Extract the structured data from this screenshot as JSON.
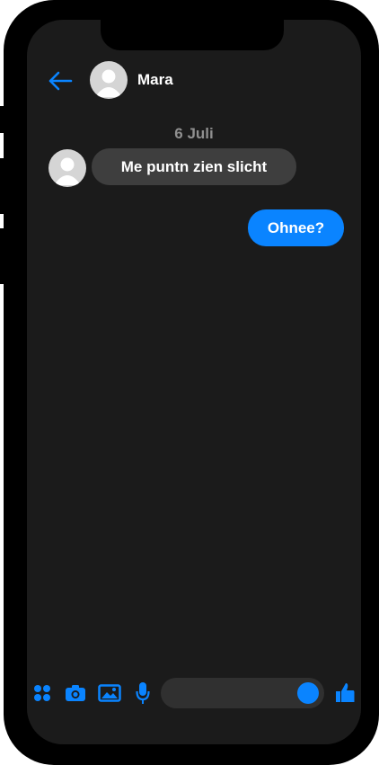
{
  "header": {
    "contact_name": "Mara",
    "back_icon": "arrow-left-icon",
    "avatar_icon": "user-avatar-icon"
  },
  "conversation": {
    "date_separator": "6 Juli",
    "messages": [
      {
        "direction": "incoming",
        "text": "Me puntn zien slicht"
      },
      {
        "direction": "outgoing",
        "text": "Ohnee?"
      }
    ]
  },
  "composer": {
    "placeholder": "",
    "icons": [
      "apps-icon",
      "camera-icon",
      "image-icon",
      "microphone-icon",
      "emoji-icon",
      "thumbs-up-icon"
    ]
  },
  "colors": {
    "accent": "#0a84ff",
    "screen_bg": "#1b1b1b",
    "incoming_bubble": "#3e3e3e",
    "date_text": "#8f8f8f"
  }
}
